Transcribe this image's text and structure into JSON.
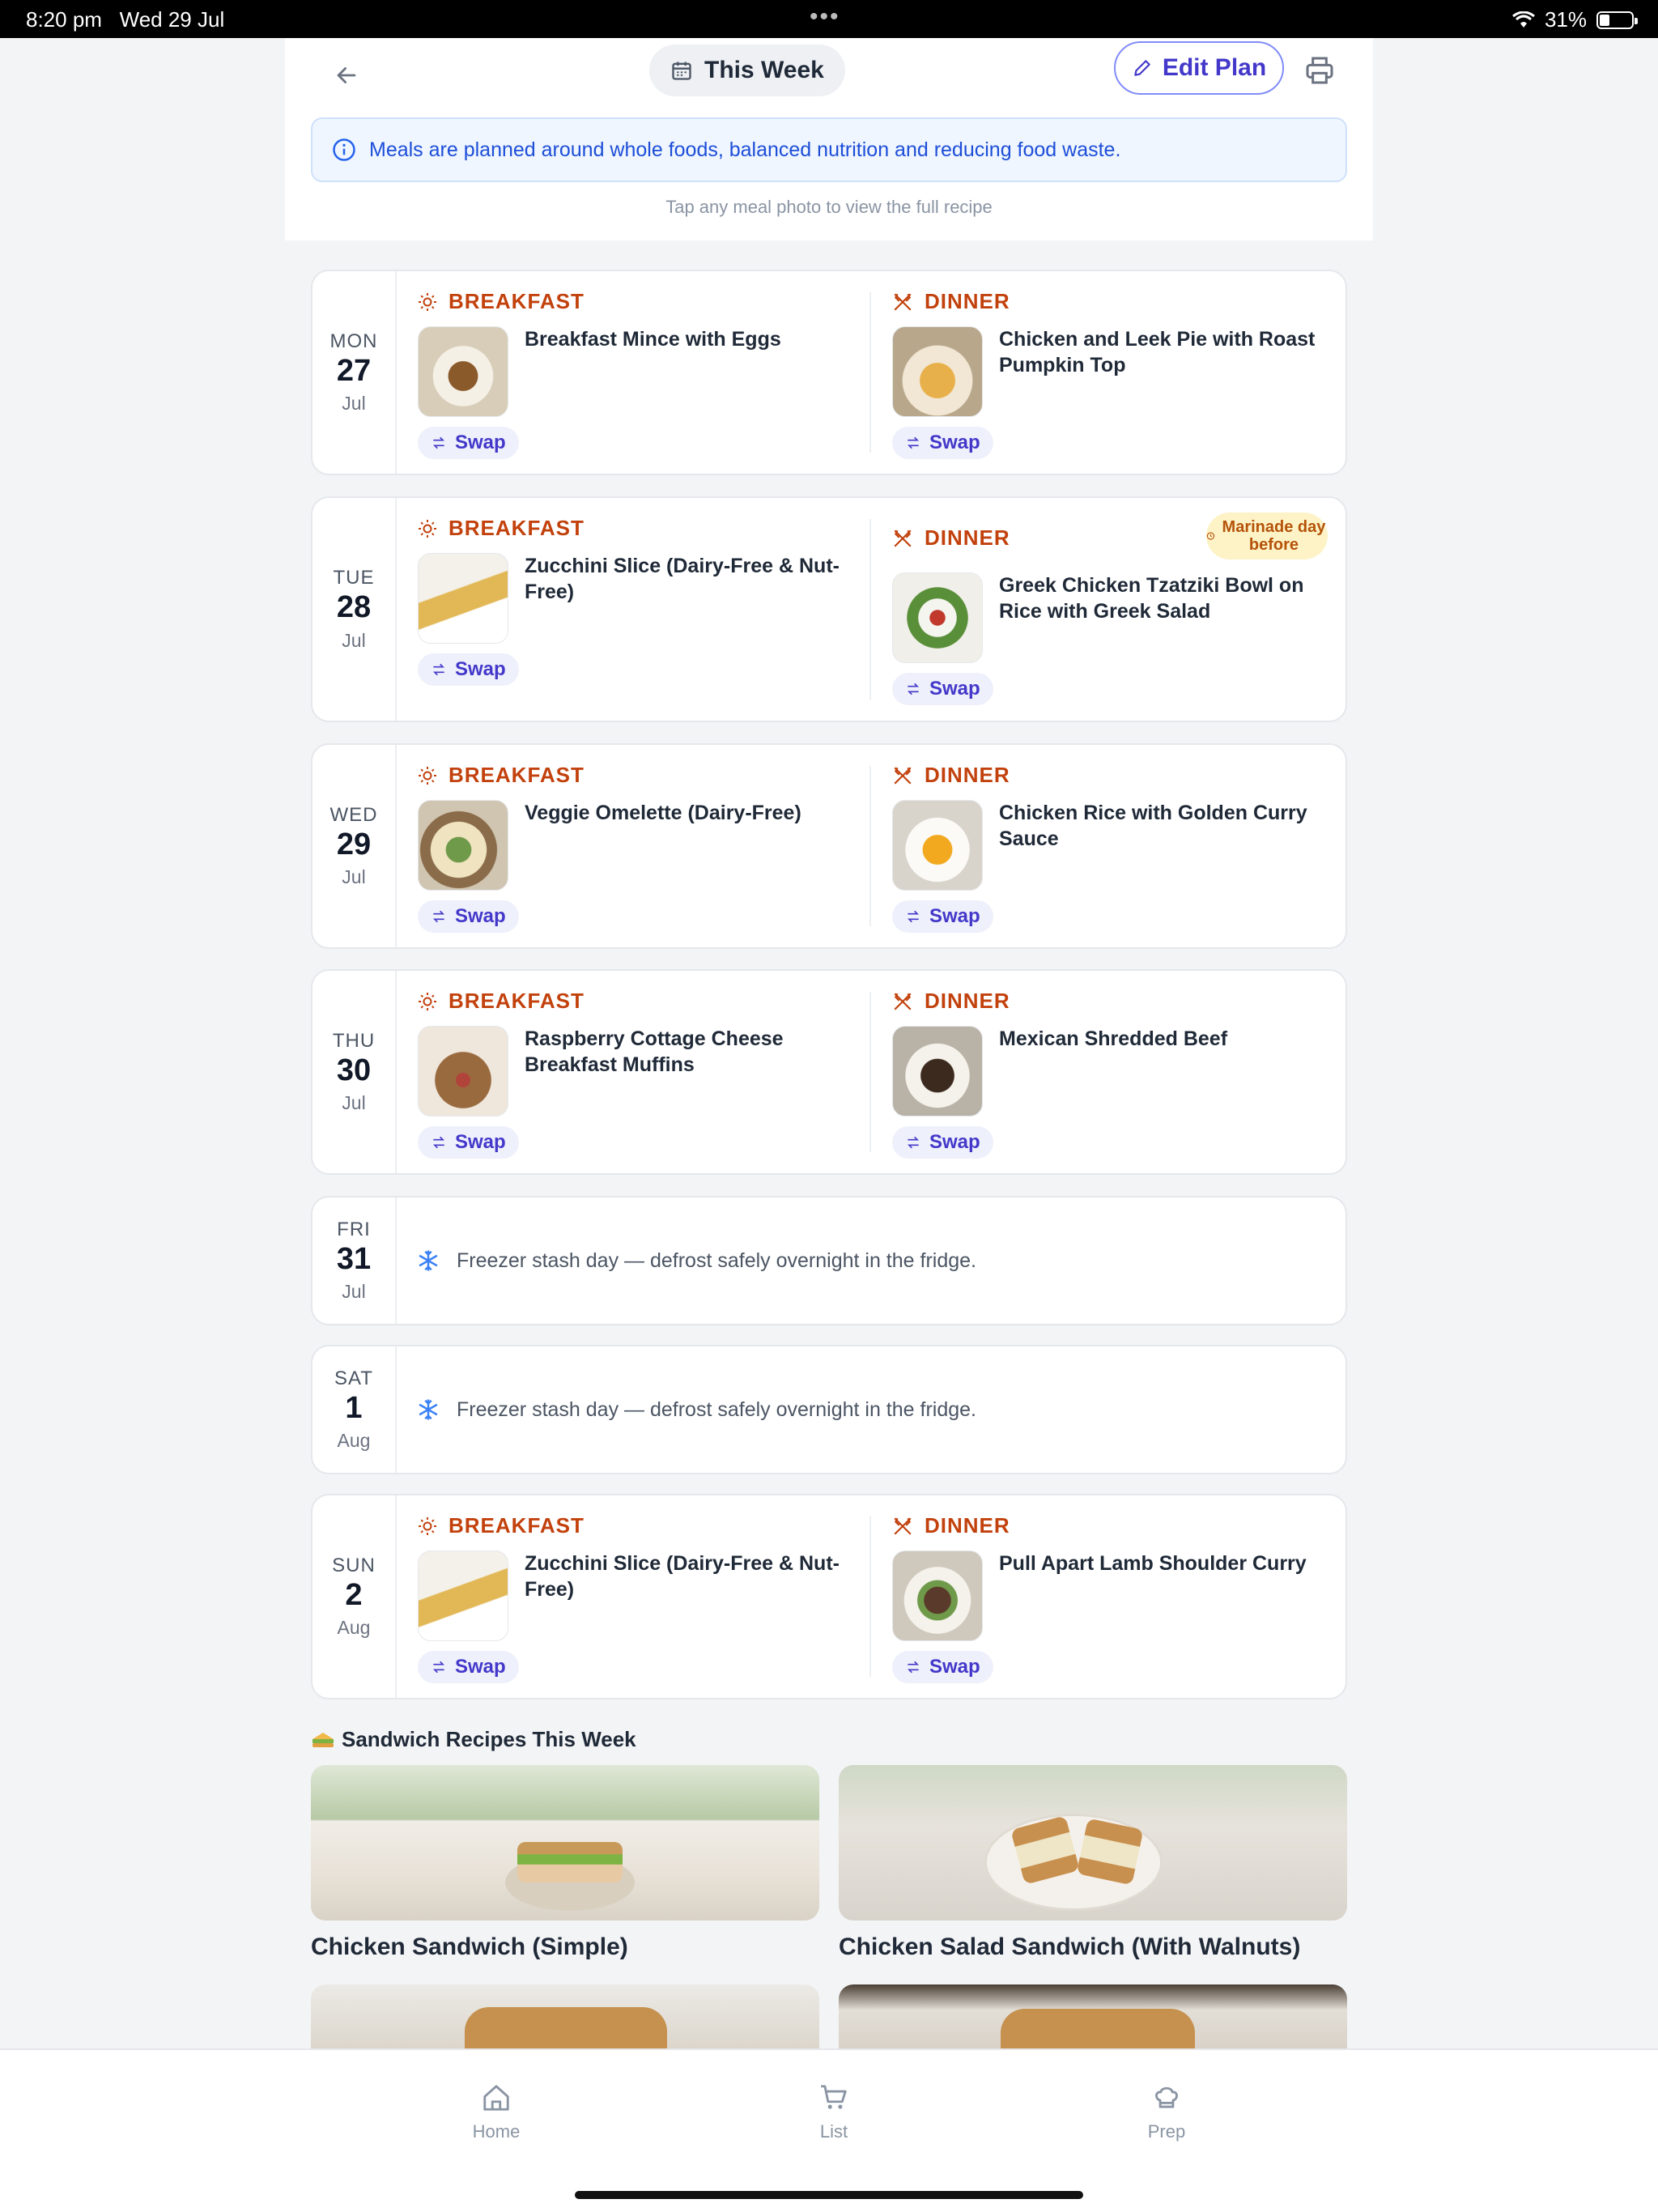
{
  "status_bar": {
    "time": "8:20 pm",
    "date": "Wed 29 Jul",
    "battery": "31%"
  },
  "header": {
    "week_label": "This Week",
    "edit_label": "Edit Plan",
    "info": "Meals are planned around whole foods, balanced nutrition and reducing food waste.",
    "hint": "Tap any meal photo to view the full recipe"
  },
  "labels": {
    "breakfast": "BREAKFAST",
    "dinner": "DINNER",
    "swap": "Swap",
    "marinade": "Marinade day before"
  },
  "days": [
    {
      "dow": "MON",
      "num": "27",
      "month": "Jul",
      "breakfast": "Breakfast Mince with Eggs",
      "dinner": "Chicken and Leek Pie with Roast Pumpkin Top"
    },
    {
      "dow": "TUE",
      "num": "28",
      "month": "Jul",
      "breakfast": "Zucchini Slice (Dairy-Free & Nut-Free)",
      "dinner": "Greek Chicken Tzatziki Bowl on Rice with Greek Salad"
    },
    {
      "dow": "WED",
      "num": "29",
      "month": "Jul",
      "breakfast": "Veggie Omelette (Dairy-Free)",
      "dinner": "Chicken Rice with Golden Curry Sauce"
    },
    {
      "dow": "THU",
      "num": "30",
      "month": "Jul",
      "breakfast": "Raspberry Cottage Cheese Breakfast Muffins",
      "dinner": "Mexican Shredded Beef"
    },
    {
      "dow": "FRI",
      "num": "31",
      "month": "Jul",
      "freezer": "Freezer stash day — defrost safely overnight in the fridge."
    },
    {
      "dow": "SAT",
      "num": "1",
      "month": "Aug",
      "freezer": "Freezer stash day — defrost safely overnight in the fridge."
    },
    {
      "dow": "SUN",
      "num": "2",
      "month": "Aug",
      "breakfast": "Zucchini Slice (Dairy-Free & Nut-Free)",
      "dinner": "Pull Apart Lamb Shoulder Curry"
    }
  ],
  "sandwiches": {
    "title": "Sandwich Recipes This Week",
    "items": [
      "Chicken Sandwich (Simple)",
      "Chicken Salad Sandwich (With Walnuts)"
    ]
  },
  "nav": {
    "home": "Home",
    "list": "List",
    "prep": "Prep"
  },
  "colors": {
    "accent": "#4338ca",
    "meal_type": "#c2410c",
    "info_bg": "#eff6ff"
  }
}
